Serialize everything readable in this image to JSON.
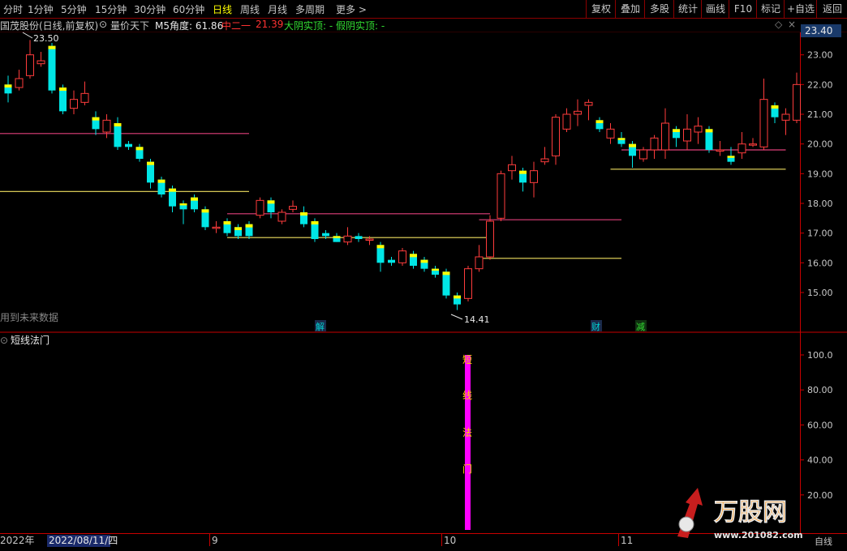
{
  "toolbar": {
    "periods": [
      "分时",
      "1分钟",
      "5分钟",
      "15分钟",
      "30分钟",
      "60分钟",
      "日线",
      "周线",
      "月线",
      "多周期",
      "更多 >"
    ],
    "active_period": "日线",
    "right_buttons": [
      "复权",
      "叠加",
      "多股",
      "统计",
      "画线",
      "F10",
      "标记",
      "+自选",
      "返回"
    ]
  },
  "info": {
    "title": "国茂股份(日线,前复权)",
    "indicator_name": "量价天下",
    "m5_label": "M5角度: 61.86",
    "mid_label": "中二一",
    "mid_value": "21.39",
    "label_a": "大阴实顶: -",
    "label_b": "假阴实顶: -"
  },
  "main_chart": {
    "current_price": "23.40",
    "high_label": "23.50",
    "low_label": "14.41",
    "future_note": "用到未来数据",
    "markers": [
      "解",
      "财",
      "减"
    ],
    "price_ticks": [
      "23.00",
      "22.00",
      "21.00",
      "20.00",
      "19.00",
      "18.00",
      "17.00",
      "16.00",
      "15.00"
    ]
  },
  "sub_chart": {
    "title": "短线法门",
    "vertical_text": [
      "短",
      "线",
      "法",
      "门"
    ],
    "ticks": [
      "100.0",
      "80.00",
      "60.00",
      "40.00",
      "20.00"
    ],
    "corner_label": "自线"
  },
  "date_axis": {
    "year_label": "2022年",
    "cursor_date": "2022/08/11/四",
    "month_labels": [
      "9",
      "10",
      "11"
    ]
  },
  "watermark": {
    "brand": "万股网",
    "url": "www.201082.com"
  },
  "chart_data": {
    "type": "candlestick",
    "y_range": [
      14.1,
      23.7
    ],
    "candles": [
      {
        "o": 22.0,
        "c": 21.7,
        "h": 22.3,
        "l": 21.4
      },
      {
        "o": 21.9,
        "c": 22.2,
        "h": 22.5,
        "l": 21.8
      },
      {
        "o": 22.3,
        "c": 23.0,
        "h": 23.5,
        "l": 22.2
      },
      {
        "o": 22.7,
        "c": 22.8,
        "h": 23.1,
        "l": 22.6
      },
      {
        "o": 23.3,
        "c": 21.8,
        "h": 23.4,
        "l": 21.7
      },
      {
        "o": 21.9,
        "c": 21.1,
        "h": 22.0,
        "l": 21.0
      },
      {
        "o": 21.2,
        "c": 21.5,
        "h": 21.8,
        "l": 21.0
      },
      {
        "o": 21.4,
        "c": 21.7,
        "h": 22.1,
        "l": 21.3
      },
      {
        "o": 20.9,
        "c": 20.5,
        "h": 21.1,
        "l": 20.3
      },
      {
        "o": 20.4,
        "c": 20.8,
        "h": 21.0,
        "l": 20.2
      },
      {
        "o": 20.7,
        "c": 19.9,
        "h": 20.9,
        "l": 19.8
      },
      {
        "o": 20.0,
        "c": 19.9,
        "h": 20.1,
        "l": 19.8
      },
      {
        "o": 19.9,
        "c": 19.5,
        "h": 20.0,
        "l": 19.4
      },
      {
        "o": 19.4,
        "c": 18.7,
        "h": 19.5,
        "l": 18.5
      },
      {
        "o": 18.8,
        "c": 18.3,
        "h": 18.9,
        "l": 18.2
      },
      {
        "o": 18.5,
        "c": 17.9,
        "h": 18.6,
        "l": 17.7
      },
      {
        "o": 18.0,
        "c": 17.8,
        "h": 18.1,
        "l": 17.3
      },
      {
        "o": 18.2,
        "c": 17.8,
        "h": 18.3,
        "l": 17.7
      },
      {
        "o": 17.8,
        "c": 17.2,
        "h": 17.9,
        "l": 17.1
      },
      {
        "o": 17.2,
        "c": 17.2,
        "h": 17.4,
        "l": 17.0
      },
      {
        "o": 17.4,
        "c": 17.0,
        "h": 17.5,
        "l": 16.9
      },
      {
        "o": 17.2,
        "c": 16.9,
        "h": 17.3,
        "l": 16.8
      },
      {
        "o": 17.3,
        "c": 16.9,
        "h": 17.4,
        "l": 16.8
      },
      {
        "o": 17.6,
        "c": 18.1,
        "h": 18.2,
        "l": 17.5
      },
      {
        "o": 18.1,
        "c": 17.7,
        "h": 18.2,
        "l": 17.5
      },
      {
        "o": 17.4,
        "c": 17.7,
        "h": 17.8,
        "l": 17.3
      },
      {
        "o": 17.8,
        "c": 17.9,
        "h": 18.1,
        "l": 17.7
      },
      {
        "o": 17.7,
        "c": 17.3,
        "h": 17.9,
        "l": 17.2
      },
      {
        "o": 17.4,
        "c": 16.8,
        "h": 17.5,
        "l": 16.7
      },
      {
        "o": 17.0,
        "c": 16.9,
        "h": 17.1,
        "l": 16.8
      },
      {
        "o": 16.9,
        "c": 16.7,
        "h": 17.0,
        "l": 16.7
      },
      {
        "o": 16.7,
        "c": 16.9,
        "h": 17.2,
        "l": 16.6
      },
      {
        "o": 16.9,
        "c": 16.8,
        "h": 17.0,
        "l": 16.7
      },
      {
        "o": 16.8,
        "c": 16.8,
        "h": 16.9,
        "l": 16.6
      },
      {
        "o": 16.6,
        "c": 16.0,
        "h": 16.7,
        "l": 15.7
      },
      {
        "o": 16.1,
        "c": 16.0,
        "h": 16.2,
        "l": 15.9
      },
      {
        "o": 16.0,
        "c": 16.4,
        "h": 16.5,
        "l": 15.9
      },
      {
        "o": 16.3,
        "c": 15.9,
        "h": 16.4,
        "l": 15.8
      },
      {
        "o": 16.1,
        "c": 15.8,
        "h": 16.2,
        "l": 15.7
      },
      {
        "o": 15.8,
        "c": 15.6,
        "h": 15.9,
        "l": 15.5
      },
      {
        "o": 15.7,
        "c": 14.9,
        "h": 15.8,
        "l": 14.8
      },
      {
        "o": 14.9,
        "c": 14.6,
        "h": 15.0,
        "l": 14.41
      },
      {
        "o": 14.8,
        "c": 15.8,
        "h": 15.9,
        "l": 14.7
      },
      {
        "o": 15.8,
        "c": 16.2,
        "h": 16.6,
        "l": 15.7
      },
      {
        "o": 16.2,
        "c": 17.4,
        "h": 17.6,
        "l": 16.1
      },
      {
        "o": 17.5,
        "c": 19.0,
        "h": 19.1,
        "l": 17.4
      },
      {
        "o": 19.1,
        "c": 19.3,
        "h": 19.6,
        "l": 18.8
      },
      {
        "o": 19.1,
        "c": 18.7,
        "h": 19.2,
        "l": 18.4
      },
      {
        "o": 18.7,
        "c": 19.1,
        "h": 19.4,
        "l": 18.2
      },
      {
        "o": 19.4,
        "c": 19.5,
        "h": 19.9,
        "l": 19.3
      },
      {
        "o": 19.6,
        "c": 20.9,
        "h": 21.0,
        "l": 19.3
      },
      {
        "o": 20.5,
        "c": 21.0,
        "h": 21.2,
        "l": 20.4
      },
      {
        "o": 21.0,
        "c": 21.1,
        "h": 21.5,
        "l": 20.6
      },
      {
        "o": 21.3,
        "c": 21.4,
        "h": 21.5,
        "l": 20.8
      },
      {
        "o": 20.8,
        "c": 20.5,
        "h": 20.9,
        "l": 20.4
      },
      {
        "o": 20.2,
        "c": 20.5,
        "h": 20.7,
        "l": 20.0
      },
      {
        "o": 20.2,
        "c": 20.0,
        "h": 20.4,
        "l": 19.9
      },
      {
        "o": 20.0,
        "c": 19.6,
        "h": 20.1,
        "l": 19.2
      },
      {
        "o": 19.5,
        "c": 19.8,
        "h": 19.9,
        "l": 19.4
      },
      {
        "o": 19.8,
        "c": 20.2,
        "h": 20.3,
        "l": 19.5
      },
      {
        "o": 19.8,
        "c": 20.7,
        "h": 21.2,
        "l": 19.5
      },
      {
        "o": 20.5,
        "c": 20.2,
        "h": 20.6,
        "l": 19.9
      },
      {
        "o": 20.1,
        "c": 20.5,
        "h": 21.0,
        "l": 19.8
      },
      {
        "o": 20.4,
        "c": 20.6,
        "h": 20.9,
        "l": 20.0
      },
      {
        "o": 20.5,
        "c": 19.8,
        "h": 20.6,
        "l": 19.7
      },
      {
        "o": 19.8,
        "c": 19.8,
        "h": 20.1,
        "l": 19.6
      },
      {
        "o": 19.6,
        "c": 19.4,
        "h": 19.9,
        "l": 19.3
      },
      {
        "o": 19.7,
        "c": 20.0,
        "h": 20.4,
        "l": 19.5
      },
      {
        "o": 20.0,
        "c": 20.0,
        "h": 20.2,
        "l": 19.9
      },
      {
        "o": 19.9,
        "c": 21.5,
        "h": 22.2,
        "l": 19.8
      },
      {
        "o": 21.3,
        "c": 20.9,
        "h": 21.4,
        "l": 20.7
      },
      {
        "o": 20.8,
        "c": 21.0,
        "h": 21.2,
        "l": 20.3
      },
      {
        "o": 20.8,
        "c": 22.0,
        "h": 22.4,
        "l": 20.7
      }
    ],
    "x_start": 2,
    "x_step": 13.5,
    "pink_levels": [
      {
        "y": 20.35,
        "from": 0,
        "to": 22
      },
      {
        "y": 17.65,
        "from": 20,
        "to": 44
      },
      {
        "y": 17.45,
        "from": 43,
        "to": 56
      },
      {
        "y": 19.8,
        "from": 56,
        "to": 71
      }
    ],
    "yellow_levels": [
      {
        "y": 18.4,
        "from": 0,
        "to": 22
      },
      {
        "y": 16.85,
        "from": 20,
        "to": 44
      },
      {
        "y": 16.15,
        "from": 43,
        "to": 56
      },
      {
        "y": 19.15,
        "from": 55,
        "to": 71
      }
    ],
    "sub_bar": {
      "index": 42,
      "value": 100
    }
  }
}
